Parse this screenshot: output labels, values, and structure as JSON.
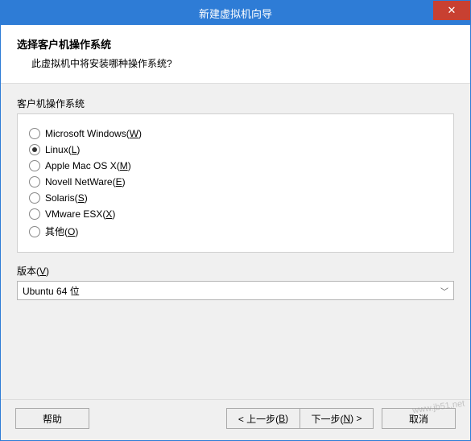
{
  "window": {
    "title": "新建虚拟机向导"
  },
  "header": {
    "title": "选择客户机操作系统",
    "subtitle": "此虚拟机中将安装哪种操作系统?"
  },
  "os_group": {
    "label": "客户机操作系统",
    "options": [
      {
        "label": "Microsoft Windows(",
        "mnemonic": "W",
        "suffix": ")",
        "checked": false
      },
      {
        "label": "Linux(",
        "mnemonic": "L",
        "suffix": ")",
        "checked": true
      },
      {
        "label": "Apple Mac OS X(",
        "mnemonic": "M",
        "suffix": ")",
        "checked": false
      },
      {
        "label": "Novell NetWare(",
        "mnemonic": "E",
        "suffix": ")",
        "checked": false
      },
      {
        "label": "Solaris(",
        "mnemonic": "S",
        "suffix": ")",
        "checked": false
      },
      {
        "label": "VMware ESX(",
        "mnemonic": "X",
        "suffix": ")",
        "checked": false
      },
      {
        "label": "其他(",
        "mnemonic": "O",
        "suffix": ")",
        "checked": false
      }
    ]
  },
  "version": {
    "label_prefix": "版本(",
    "label_mnemonic": "V",
    "label_suffix": ")",
    "selected": "Ubuntu 64 位"
  },
  "footer": {
    "help": "帮助",
    "back_prefix": "< 上一步(",
    "back_mnemonic": "B",
    "back_suffix": ")",
    "next_prefix": "下一步(",
    "next_mnemonic": "N",
    "next_suffix": ") >",
    "cancel": "取消"
  },
  "watermark": "www.jb51.net"
}
